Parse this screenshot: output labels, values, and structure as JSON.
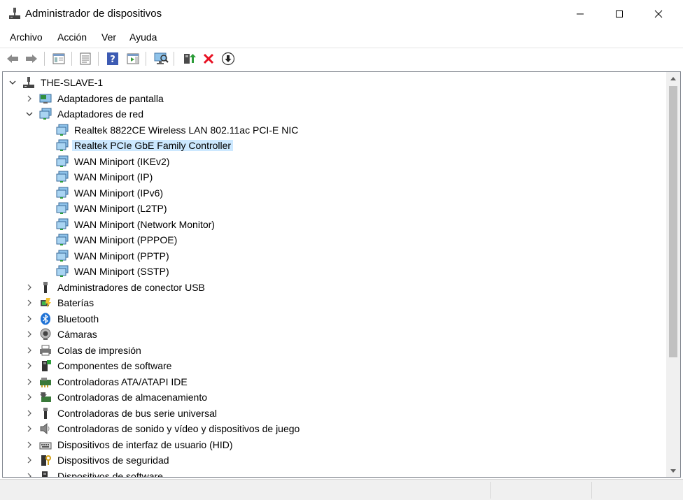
{
  "window": {
    "title": "Administrador de dispositivos"
  },
  "menu": [
    "Archivo",
    "Acción",
    "Ver",
    "Ayuda"
  ],
  "toolbar": {
    "buttons": [
      "back-icon",
      "forward-icon",
      "show-hide-console-tree-icon",
      "properties-icon",
      "help-icon",
      "action-pane-icon",
      "scan-hardware-icon",
      "update-driver-icon",
      "uninstall-device-icon",
      "disable-device-icon"
    ]
  },
  "tree": {
    "root": "THE-SLAVE-1",
    "categories": [
      {
        "label": "Adaptadores de pantalla",
        "icon": "display-adapter-icon",
        "expanded": false
      },
      {
        "label": "Adaptadores de red",
        "icon": "network-adapter-icon",
        "expanded": true,
        "children": [
          {
            "label": "Realtek 8822CE Wireless LAN 802.11ac PCI-E NIC",
            "selected": false
          },
          {
            "label": "Realtek PCIe GbE Family Controller",
            "selected": true
          },
          {
            "label": "WAN Miniport (IKEv2)",
            "selected": false
          },
          {
            "label": "WAN Miniport (IP)",
            "selected": false
          },
          {
            "label": "WAN Miniport (IPv6)",
            "selected": false
          },
          {
            "label": "WAN Miniport (L2TP)",
            "selected": false
          },
          {
            "label": "WAN Miniport (Network Monitor)",
            "selected": false
          },
          {
            "label": "WAN Miniport (PPPOE)",
            "selected": false
          },
          {
            "label": "WAN Miniport (PPTP)",
            "selected": false
          },
          {
            "label": "WAN Miniport (SSTP)",
            "selected": false
          }
        ]
      },
      {
        "label": "Administradores de conector USB",
        "icon": "usb-connector-icon",
        "expanded": false
      },
      {
        "label": "Baterías",
        "icon": "battery-icon",
        "expanded": false
      },
      {
        "label": "Bluetooth",
        "icon": "bluetooth-icon",
        "expanded": false
      },
      {
        "label": "Cámaras",
        "icon": "camera-icon",
        "expanded": false
      },
      {
        "label": "Colas de impresión",
        "icon": "printer-icon",
        "expanded": false
      },
      {
        "label": "Componentes de software",
        "icon": "software-component-icon",
        "expanded": false
      },
      {
        "label": "Controladoras ATA/ATAPI IDE",
        "icon": "ide-controller-icon",
        "expanded": false
      },
      {
        "label": "Controladoras de almacenamiento",
        "icon": "storage-controller-icon",
        "expanded": false
      },
      {
        "label": "Controladoras de bus serie universal",
        "icon": "usb-controller-icon",
        "expanded": false
      },
      {
        "label": "Controladoras de sonido y vídeo y dispositivos de juego",
        "icon": "sound-icon",
        "expanded": false
      },
      {
        "label": "Dispositivos de interfaz de usuario (HID)",
        "icon": "hid-icon",
        "expanded": false
      },
      {
        "label": "Dispositivos de seguridad",
        "icon": "security-device-icon",
        "expanded": false
      },
      {
        "label": "Dispositivos de software",
        "icon": "software-device-icon",
        "expanded": false
      }
    ]
  },
  "colors": {
    "selection": "#cce8ff",
    "scroll_thumb": "#c1c1c1",
    "uninstall": "#e81123"
  }
}
